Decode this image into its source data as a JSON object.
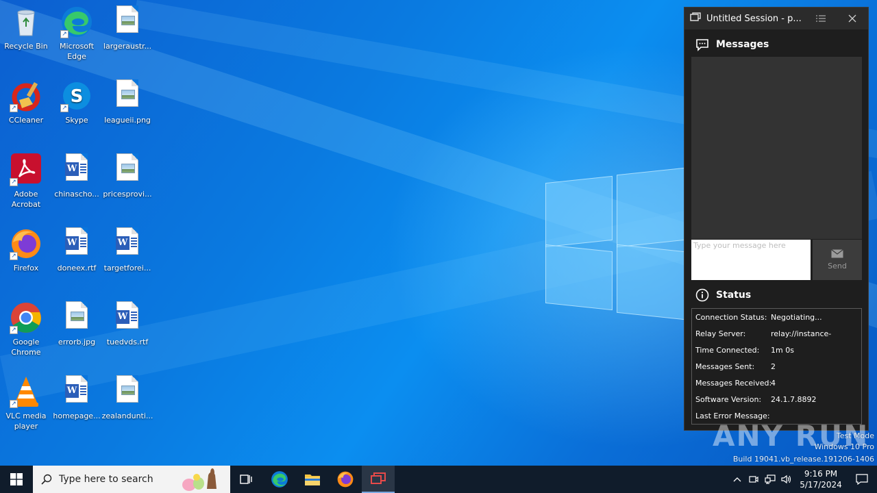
{
  "desktop": {
    "icons": [
      {
        "label": "Recycle Bin",
        "icon": "recycle-bin-icon"
      },
      {
        "label": "Microsoft Edge",
        "icon": "edge-icon"
      },
      {
        "label": "largeraustr...",
        "icon": "image-file-icon"
      },
      {
        "label": "CCleaner",
        "icon": "ccleaner-icon"
      },
      {
        "label": "Skype",
        "icon": "skype-icon"
      },
      {
        "label": "leagueii.png",
        "icon": "image-file-icon"
      },
      {
        "label": "Adobe Acrobat",
        "icon": "acrobat-icon"
      },
      {
        "label": "chinascho...",
        "icon": "word-doc-icon"
      },
      {
        "label": "pricesprovi...",
        "icon": "image-file-icon"
      },
      {
        "label": "Firefox",
        "icon": "firefox-icon"
      },
      {
        "label": "doneex.rtf",
        "icon": "word-doc-icon"
      },
      {
        "label": "targetforei...",
        "icon": "word-doc-icon"
      },
      {
        "label": "Google Chrome",
        "icon": "chrome-icon"
      },
      {
        "label": "errorb.jpg",
        "icon": "image-file-icon"
      },
      {
        "label": "tuedvds.rtf",
        "icon": "word-doc-icon"
      },
      {
        "label": "VLC media player",
        "icon": "vlc-icon"
      },
      {
        "label": "homepage...",
        "icon": "word-doc-icon"
      },
      {
        "label": "zealandunti...",
        "icon": "image-file-icon"
      }
    ]
  },
  "session_window": {
    "title": "Untitled Session - p...",
    "messages_heading": "Messages",
    "input_placeholder": "Type your message here",
    "send_label": "Send",
    "status_heading": "Status",
    "status_rows": [
      {
        "key": "Connection Status:",
        "value": "Negotiating..."
      },
      {
        "key": "Relay Server:",
        "value": "relay://instance-"
      },
      {
        "key": "Time Connected:",
        "value": "1m 0s"
      },
      {
        "key": "Messages Sent:",
        "value": "2"
      },
      {
        "key": "Messages Received:",
        "value": "4"
      },
      {
        "key": "Software Version:",
        "value": "24.1.7.8892"
      },
      {
        "key": "Last Error Message:",
        "value": ""
      }
    ]
  },
  "watermark": {
    "line1": "Test Mode",
    "line2": "Windows 10 Pro",
    "line3": "Build 19041.vb_release.191206-1406",
    "brand": "ANY RUN"
  },
  "taskbar": {
    "search_placeholder": "Type here to search",
    "time": "9:16 PM",
    "date": "5/17/2024"
  }
}
